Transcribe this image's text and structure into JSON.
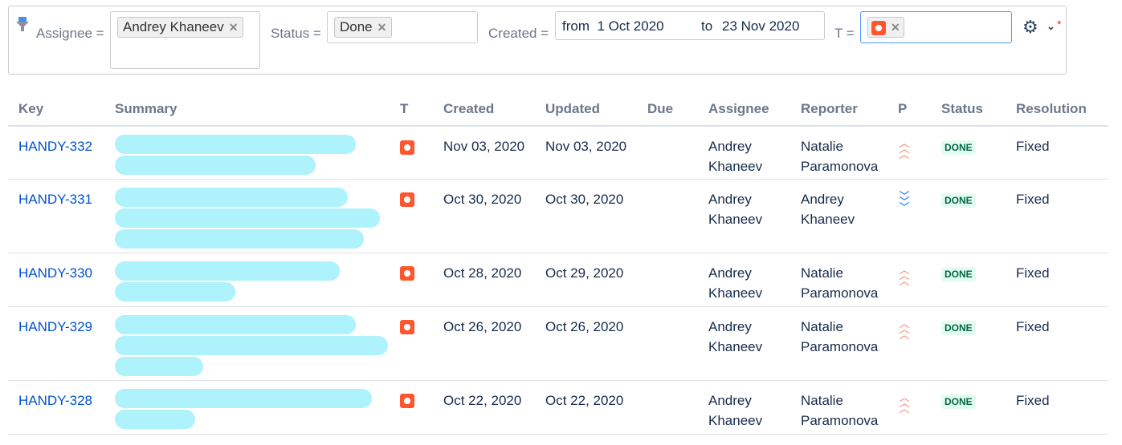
{
  "filters": {
    "assignee_label": "Assignee =",
    "assignee_value": "Andrey Khaneev",
    "status_label": "Status =",
    "status_value": "Done",
    "created_label": "Created =",
    "from_label": "from",
    "from_value": "1 Oct 2020",
    "to_label": "to",
    "to_value": "23 Nov 2020",
    "type_label": "T =",
    "asterisk": "*"
  },
  "columns": [
    "Key",
    "Summary",
    "T",
    "Created",
    "Updated",
    "Due",
    "Assignee",
    "Reporter",
    "P",
    "Status",
    "Resolution"
  ],
  "rows": [
    {
      "key": "HANDY-332",
      "created": "Nov 03, 2020",
      "updated": "Nov 03, 2020",
      "assignee": [
        "Andrey",
        "Khaneev"
      ],
      "reporter": [
        "Natalie",
        "Paramonova"
      ],
      "priority": "high",
      "status": "DONE",
      "resolution": "Fixed"
    },
    {
      "key": "HANDY-331",
      "created": "Oct 30, 2020",
      "updated": "Oct 30, 2020",
      "assignee": [
        "Andrey",
        "Khaneev"
      ],
      "reporter": [
        "Andrey",
        "Khaneev"
      ],
      "priority": "lowest",
      "status": "DONE",
      "resolution": "Fixed"
    },
    {
      "key": "HANDY-330",
      "created": "Oct 28, 2020",
      "updated": "Oct 29, 2020",
      "assignee": [
        "Andrey",
        "Khaneev"
      ],
      "reporter": [
        "Natalie",
        "Paramonova"
      ],
      "priority": "high",
      "status": "DONE",
      "resolution": "Fixed"
    },
    {
      "key": "HANDY-329",
      "created": "Oct 26, 2020",
      "updated": "Oct 26, 2020",
      "assignee": [
        "Andrey",
        "Khaneev"
      ],
      "reporter": [
        "Natalie",
        "Paramonova"
      ],
      "priority": "high",
      "status": "DONE",
      "resolution": "Fixed"
    },
    {
      "key": "HANDY-328",
      "created": "Oct 22, 2020",
      "updated": "Oct 22, 2020",
      "assignee": [
        "Andrey",
        "Khaneev"
      ],
      "reporter": [
        "Natalie",
        "Paramonova"
      ],
      "priority": "high",
      "status": "DONE",
      "resolution": "Fixed"
    }
  ],
  "colors": {
    "high": "#ff7452",
    "lowest": "#0065ff",
    "link": "#0052cc"
  }
}
